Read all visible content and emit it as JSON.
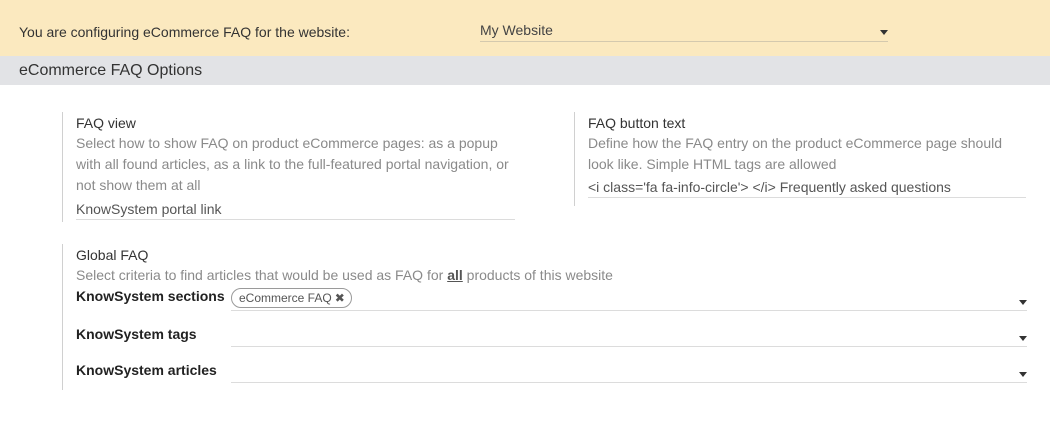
{
  "website_bar": {
    "label": "You are configuring eCommerce FAQ for the website:",
    "selected_website": "My Website"
  },
  "section": {
    "title": "eCommerce FAQ Options"
  },
  "faq_view": {
    "heading": "FAQ view",
    "description": "Select how to show FAQ on product eCommerce pages: as a popup with all found articles, as a link to the full-featured portal navigation, or not show them at all",
    "value": "KnowSystem portal link"
  },
  "faq_button_text": {
    "heading": "FAQ button text",
    "description": "Define how the FAQ entry on the product eCommerce page should look like. Simple HTML tags are allowed",
    "value": "<i class='fa fa-info-circle'> </i> Frequently asked questions"
  },
  "global_faq": {
    "heading": "Global FAQ",
    "description_before": "Select criteria to find articles that would be used as FAQ for ",
    "description_bold": "all",
    "description_after": " products of this website",
    "sections_label": "KnowSystem sections",
    "sections_tags": [
      "eCommerce FAQ"
    ],
    "tag_remove_glyph": "✖",
    "tags_label": "KnowSystem tags",
    "articles_label": "KnowSystem articles"
  },
  "icons": {
    "dropdown": "chevron-down-icon",
    "remove_tag": "close-icon"
  }
}
